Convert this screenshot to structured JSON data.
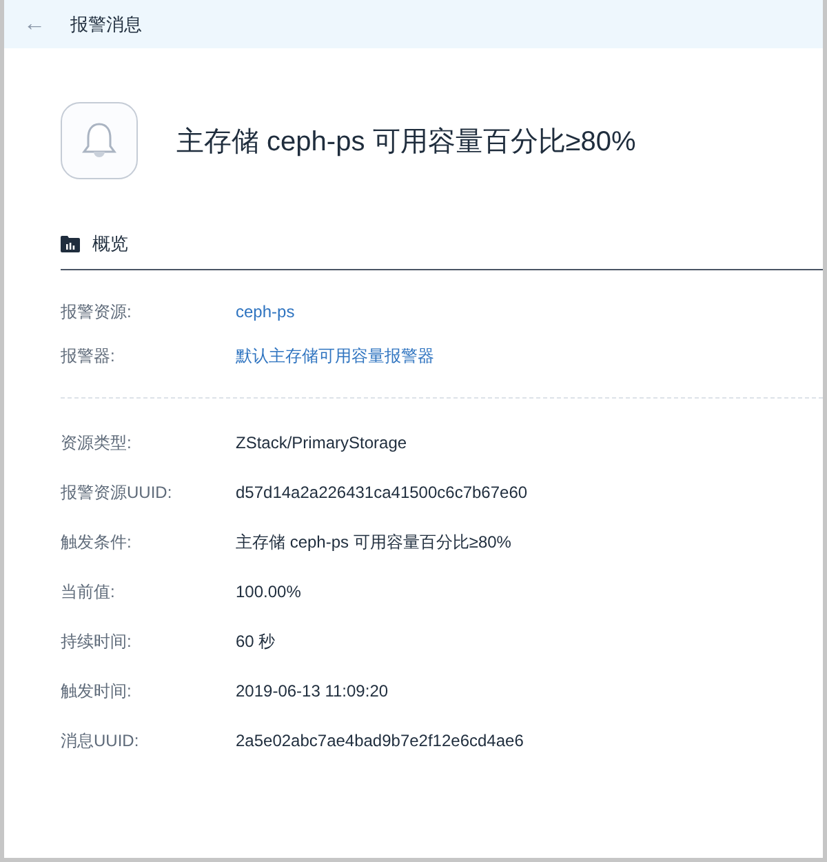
{
  "header": {
    "back": "←",
    "title": "报警消息"
  },
  "alert": {
    "title": "主存储 ceph-ps 可用容量百分比≥80%"
  },
  "section": {
    "title": "概览"
  },
  "groups": [
    {
      "rows": [
        {
          "label": "报警资源:",
          "value": "ceph-ps",
          "kind": "link"
        },
        {
          "label": "报警器:",
          "value": "默认主存储可用容量报警器",
          "kind": "link"
        }
      ]
    },
    {
      "rows": [
        {
          "label": "资源类型:",
          "value": "ZStack/PrimaryStorage",
          "kind": "text"
        },
        {
          "label": "报警资源UUID:",
          "value": "d57d14a2a226431ca41500c6c7b67e60",
          "kind": "text"
        },
        {
          "label": "触发条件:",
          "value": "主存储 ceph-ps 可用容量百分比≥80%",
          "kind": "text"
        },
        {
          "label": "当前值:",
          "value": "100.00%",
          "kind": "text"
        },
        {
          "label": "持续时间:",
          "value": "60 秒",
          "kind": "text"
        },
        {
          "label": "触发时间:",
          "value": "2019-06-13 11:09:20",
          "kind": "text"
        },
        {
          "label": "消息UUID:",
          "value": "2a5e02abc7ae4bad9b7e2f12e6cd4ae6",
          "kind": "text"
        }
      ]
    }
  ]
}
